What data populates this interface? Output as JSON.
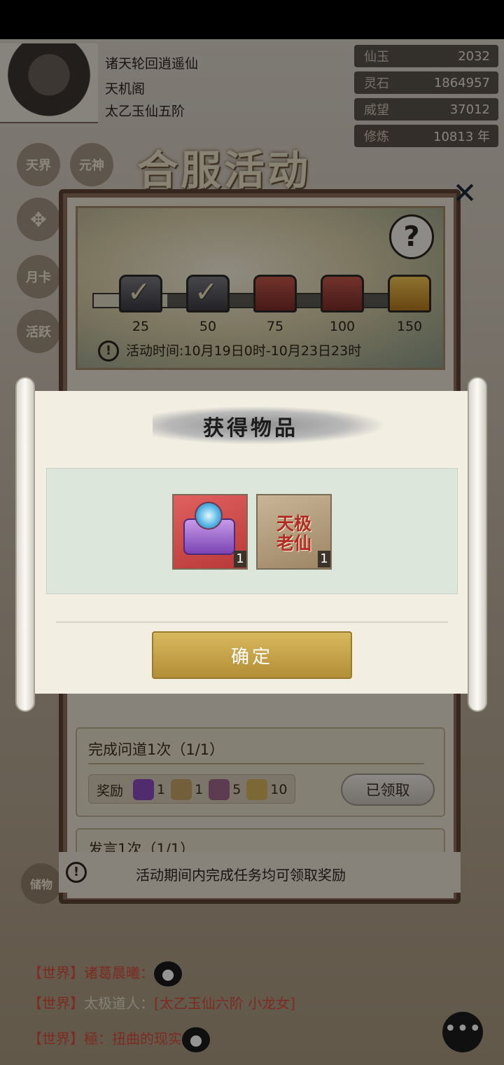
{
  "profile": {
    "name": "诸天轮回逍遥仙",
    "sect": "天机阁",
    "realm": "太乙玉仙五阶"
  },
  "stats": [
    {
      "label": "仙玉",
      "value": "2032"
    },
    {
      "label": "灵石",
      "value": "1864957"
    },
    {
      "label": "威望",
      "value": "37012"
    },
    {
      "label": "修炼",
      "value": "10813 年"
    }
  ],
  "side_menu": {
    "tianjie": "天界",
    "yuanshen": "元神",
    "yueka": "月卡",
    "huoyue": "活跃",
    "chuwu": "储物"
  },
  "activity": {
    "title": "合服活动",
    "time": "活动时间:10月19日0时-10月23日23时",
    "progress_fraction": 0.22,
    "milestones": [
      "25",
      "50",
      "75",
      "100",
      "150"
    ],
    "notice": "活动期间内完成任务均可领取奖励"
  },
  "tasks": [
    {
      "title": "完成问道1次（1/1）",
      "reward_label": "奖励",
      "rewards": [
        "1",
        "1",
        "5",
        "10"
      ],
      "button": "已领取"
    },
    {
      "title": "发言1次（1/1）"
    }
  ],
  "chat": [
    {
      "channel": "【世界】",
      "name": "诸葛晨曦：",
      "text": ""
    },
    {
      "channel": "【世界】",
      "name": "太极道人：",
      "text": "[太乙玉仙六阶 小龙女]"
    },
    {
      "channel": "【世界】",
      "name": "極：",
      "text": "扭曲的现实"
    }
  ],
  "dialog": {
    "title": "获得物品",
    "items": [
      {
        "name": "chest",
        "count": "1"
      },
      {
        "name": "天极老仙",
        "count": "1"
      }
    ],
    "item_title_text": "天极\n老仙",
    "confirm": "确定"
  },
  "icons": {
    "close": "close-icon",
    "help": "help-icon",
    "warning": "warning-icon",
    "chat": "chat-icon"
  }
}
